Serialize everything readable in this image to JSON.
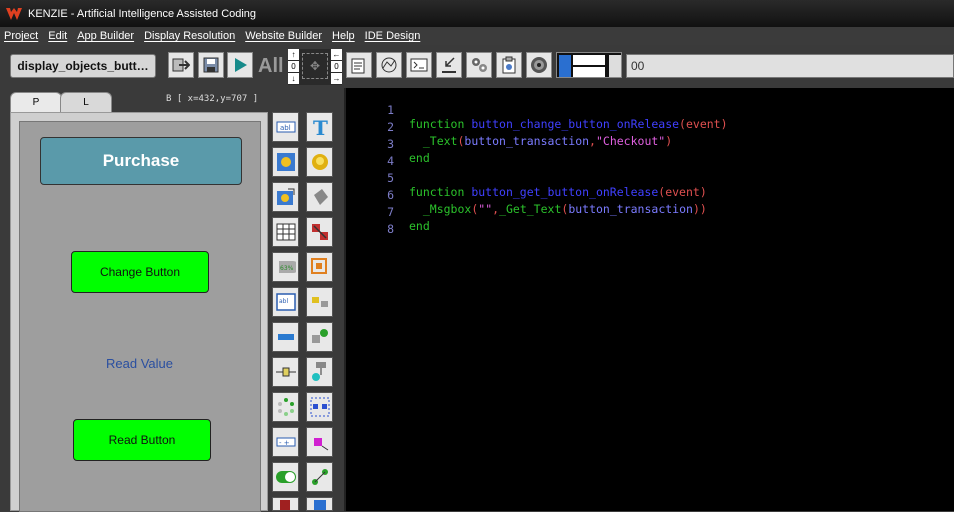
{
  "window": {
    "title": "KENZIE - Artificial Intelligence Assisted Coding"
  },
  "menu": [
    "Project",
    "Edit",
    "App Builder",
    "Display Resolution",
    "Website Builder",
    "Help",
    "IDE Design"
  ],
  "toolbar": {
    "file_tab": "display_objects_butt…",
    "all_label": "All",
    "position_value": "00",
    "icons": [
      "exit-icon",
      "save-icon",
      "run-icon",
      "move-icon",
      "properties-icon",
      "chart-icon",
      "terminal-icon",
      "import-icon",
      "settings-gears-icon",
      "clipboard-icon",
      "audio-icon",
      "align-icon"
    ]
  },
  "left_panel": {
    "tabs": [
      "P",
      "L"
    ],
    "coords": "B [ x=432,y=707 ]",
    "canvas": {
      "purchase_label": "Purchase",
      "change_button_label": "Change Button",
      "read_value_label": "Read Value",
      "read_button_label": "Read Button",
      "purchase_color": "#5a9aaa",
      "button_color": "#00ff00"
    },
    "palette_icons": [
      "text-label-icon",
      "text-tool-icon",
      "image-icon",
      "button-icon",
      "animated-image-icon",
      "shape-icon",
      "table-icon",
      "delete-object-icon",
      "progress-icon",
      "resize-icon",
      "textbox-icon",
      "align-icon",
      "slider-icon",
      "connect-icon",
      "scrollbar-icon",
      "group-icon",
      "spinner-icon",
      "layout-icon",
      "stepper-icon",
      "link-icon",
      "toggle-icon",
      "path-icon",
      "misc-icon-1",
      "misc-icon-2"
    ]
  },
  "editor": {
    "lines": [
      {
        "num": "1"
      },
      {
        "num": "2"
      },
      {
        "num": "3"
      },
      {
        "num": "4"
      },
      {
        "num": "5"
      },
      {
        "num": "6"
      },
      {
        "num": "7"
      },
      {
        "num": "8"
      }
    ],
    "tokens": {
      "function_kw": "function",
      "end_kw": "end",
      "fn1": "button_change_button_onRelease",
      "event": "event",
      "text_call": "_Text",
      "button_transaction": "button_transaction",
      "checkout": "\"Checkout\"",
      "fn2": "button_get_button_onRelease",
      "msgbox": "_Msgbox",
      "empty_str": "\"\"",
      "get_text": "_Get_Text"
    }
  }
}
